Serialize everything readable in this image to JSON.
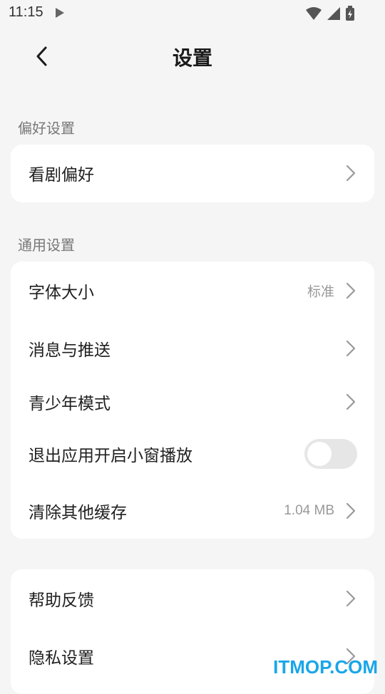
{
  "status_bar": {
    "time": "11:15",
    "icons": [
      "play-icon",
      "wifi-icon",
      "signal-icon",
      "battery-icon"
    ]
  },
  "header": {
    "title": "设置",
    "back_icon": "back-arrow-icon"
  },
  "sections": [
    {
      "title": "偏好设置",
      "items": [
        {
          "label": "看剧偏好",
          "value": "",
          "control": "chevron"
        }
      ]
    },
    {
      "title": "通用设置",
      "items": [
        {
          "label": "字体大小",
          "value": "标准",
          "control": "chevron"
        },
        {
          "label": "消息与推送",
          "value": "",
          "control": "chevron"
        },
        {
          "label": "青少年模式",
          "value": "",
          "control": "chevron"
        },
        {
          "label": "退出应用开启小窗播放",
          "value": "",
          "control": "toggle",
          "toggle_on": false
        },
        {
          "label": "清除其他缓存",
          "value": "1.04 MB",
          "control": "chevron"
        }
      ]
    },
    {
      "title": "",
      "items": [
        {
          "label": "帮助反馈",
          "value": "",
          "control": "chevron"
        },
        {
          "label": "隐私设置",
          "value": "",
          "control": "chevron"
        }
      ]
    }
  ],
  "watermark": "ITMOP.COM",
  "colors": {
    "background": "#f5f5f5",
    "card": "#ffffff",
    "section_title": "#777777",
    "value_text": "#999999",
    "toggle_off": "#e6e6e6",
    "watermark": "#1aa6e8"
  }
}
